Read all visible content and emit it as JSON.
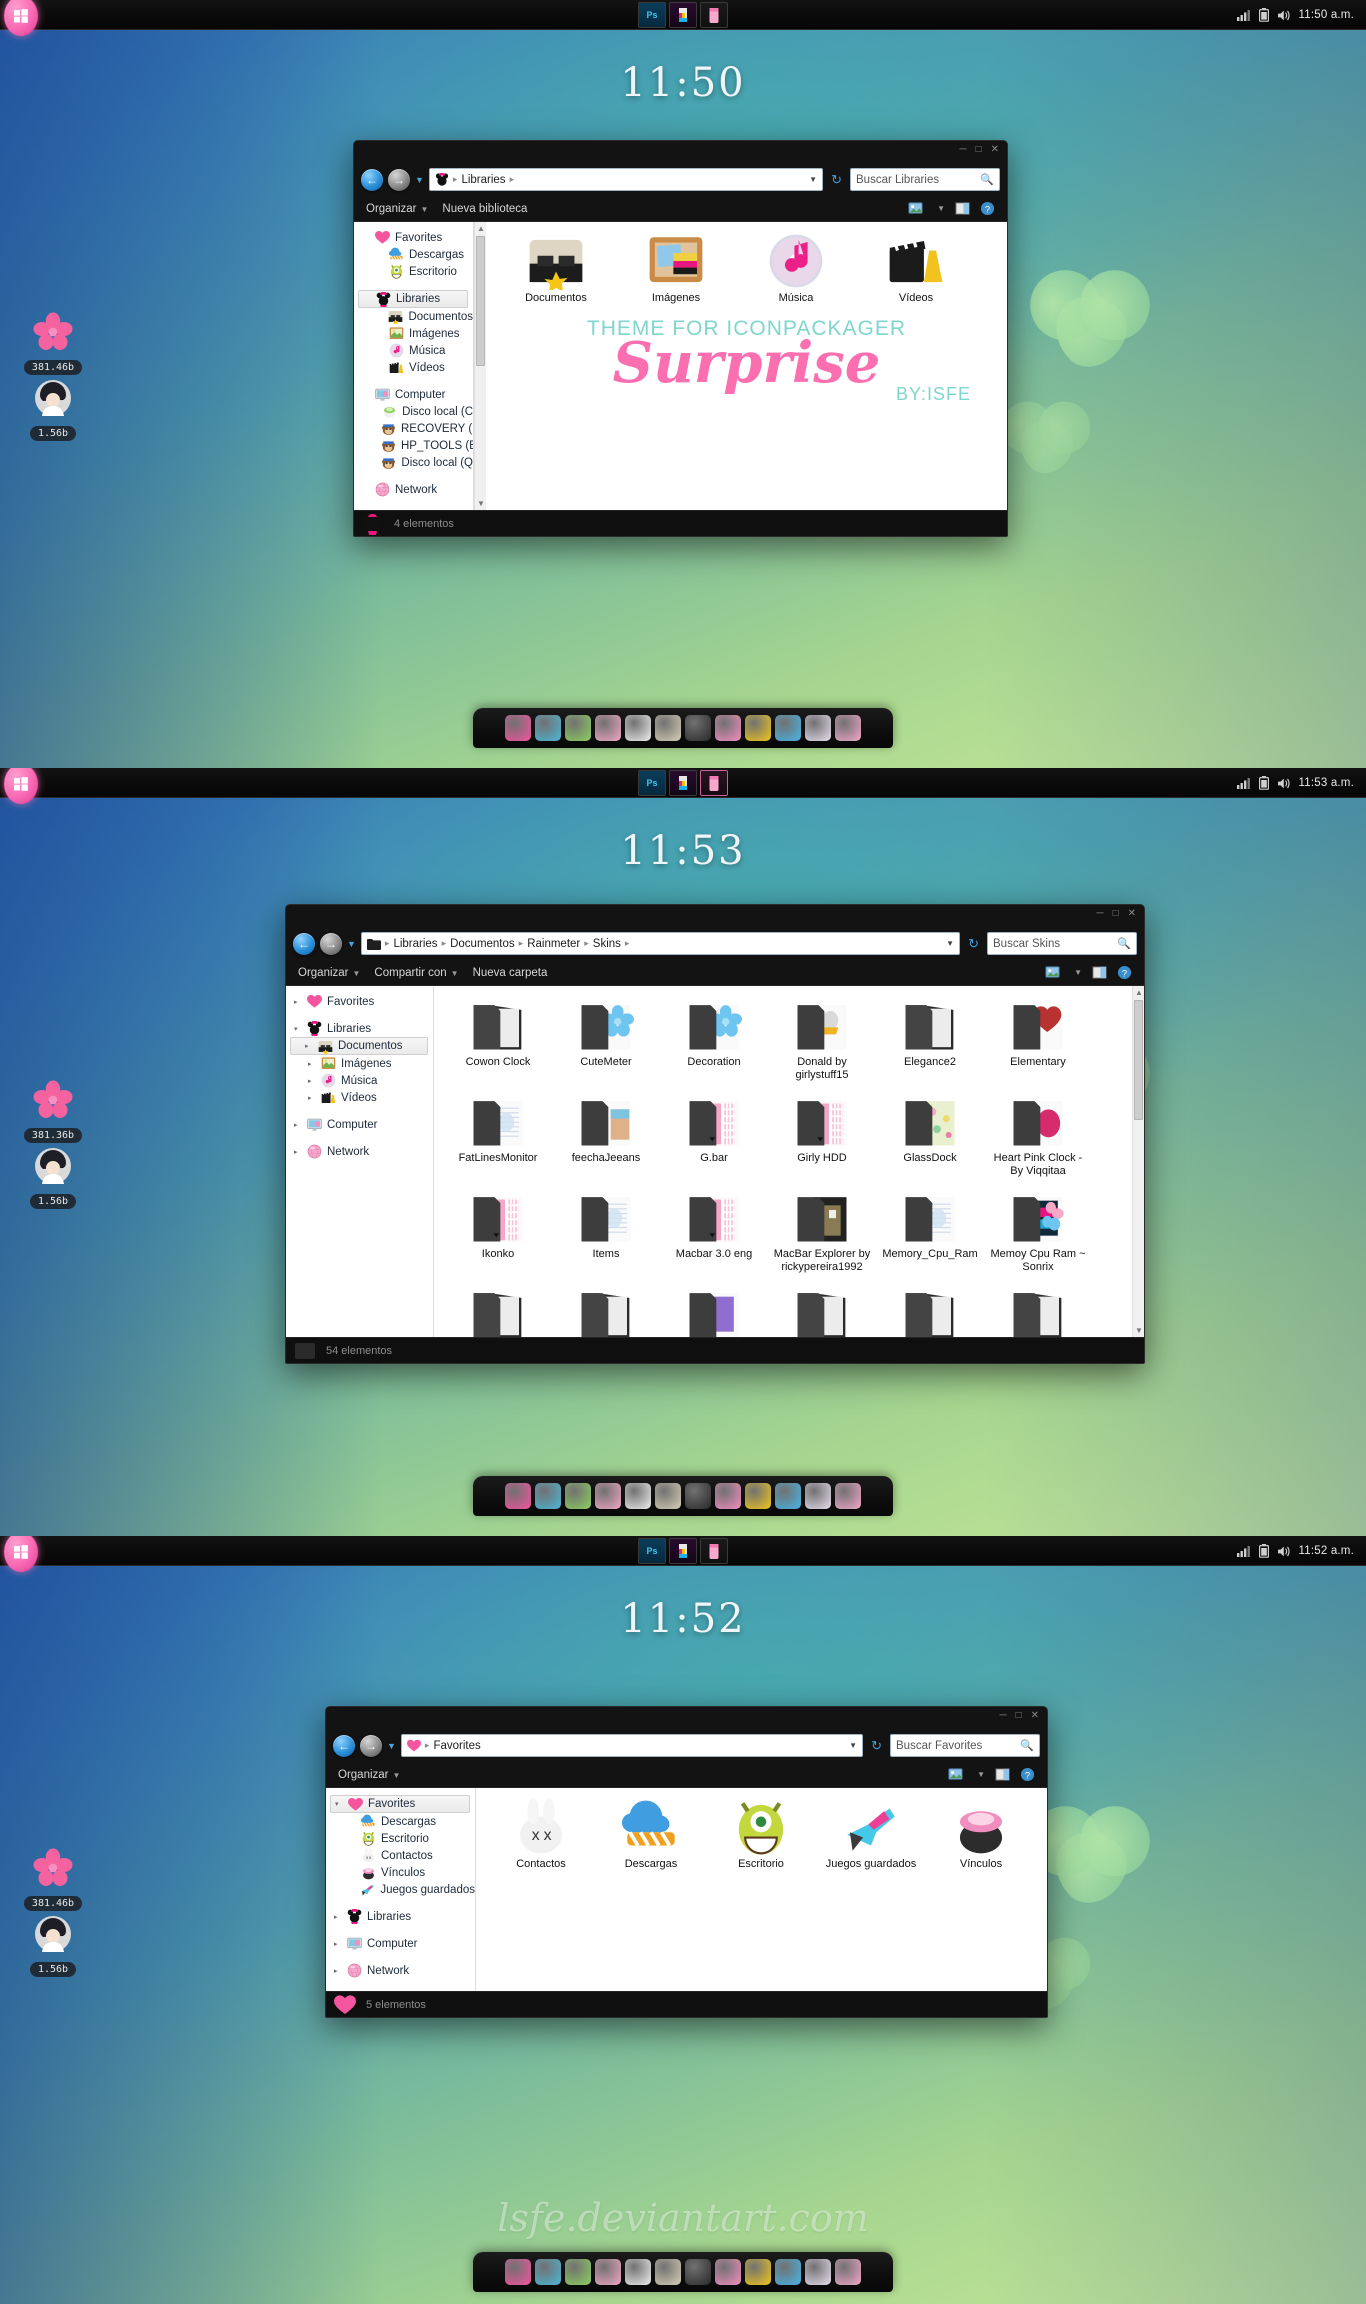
{
  "taskbar": {
    "start_icon": "windows-start-orb",
    "buttons": [
      {
        "name": "photoshop-taskbar-button",
        "label": "Ps"
      },
      {
        "name": "paint-taskbar-button",
        "label": ""
      },
      {
        "name": "pink-app-taskbar-button",
        "label": ""
      }
    ],
    "tray_icons": [
      "network-signal-icon",
      "battery-icon",
      "volume-icon"
    ],
    "clocks": [
      "11:50 a.m.",
      "11:53 a.m.",
      "11:52 a.m."
    ]
  },
  "desktop": {
    "clocks": [
      "11:50",
      "11:53",
      "11:52"
    ],
    "gadgets": [
      {
        "icon": "pink-flower-drive-gadget",
        "value": "381.46b"
      },
      {
        "icon": "girl-avatar-drive-gadget",
        "value": "1.56b"
      }
    ],
    "gadgets_panel2": [
      {
        "icon": "pink-flower-drive-gadget",
        "value": "381.36b"
      },
      {
        "icon": "girl-avatar-drive-gadget",
        "value": "1.56b"
      }
    ],
    "gadgets_panel3": [
      {
        "icon": "pink-flower-drive-gadget",
        "value": "381.46b"
      },
      {
        "icon": "girl-avatar-drive-gadget",
        "value": "1.56b"
      }
    ],
    "watermark": "lsfe.deviantart.com",
    "dock_icons": [
      "minnie-icon",
      "watering-can-icon",
      "green-dragon-icon",
      "photoshop-pink-icon",
      "white-ghost-icon",
      "glasses-folder-icon",
      "film-clapper-icon",
      "quotes-icon",
      "toolbox-icon",
      "water-drop-icon",
      "pictures-icon",
      "pink-globe-icon"
    ]
  },
  "window1": {
    "nav": {
      "back_icon": "back-arrow-icon",
      "forward_icon": "forward-arrow-icon",
      "history_icon": "history-dropdown-icon",
      "breadcrumb_icon": "minnie-libraries-icon",
      "breadcrumbs": [
        "Libraries"
      ],
      "refresh_icon": "refresh-icon",
      "search_placeholder": "Buscar Libraries",
      "search_icon": "search-icon"
    },
    "toolbar": {
      "organize": "Organizar",
      "new_library": "Nueva biblioteca",
      "view_icon": "change-view-icon",
      "preview_icon": "preview-pane-icon",
      "help_icon": "help-icon"
    },
    "sidebar": [
      {
        "label": "Favorites",
        "icon": "pink-heart-icon",
        "level": 0,
        "selected": false,
        "arrow": false
      },
      {
        "label": "Descargas",
        "icon": "blue-cloud-icon",
        "level": 1,
        "selected": false,
        "arrow": false
      },
      {
        "label": "Escritorio",
        "icon": "green-monster-icon",
        "level": 1,
        "selected": false,
        "arrow": false
      },
      {
        "gap": true
      },
      {
        "label": "Libraries",
        "icon": "minnie-icon",
        "level": 0,
        "selected": true,
        "arrow": false
      },
      {
        "label": "Documentos",
        "icon": "documents-glasses-icon",
        "level": 1,
        "selected": false,
        "arrow": false
      },
      {
        "label": "Imágenes",
        "icon": "pictures-icon",
        "level": 1,
        "selected": false,
        "arrow": false
      },
      {
        "label": "Música",
        "icon": "music-cd-icon",
        "level": 1,
        "selected": false,
        "arrow": false
      },
      {
        "label": "Vídeos",
        "icon": "video-clapper-icon",
        "level": 1,
        "selected": false,
        "arrow": false
      },
      {
        "gap": true
      },
      {
        "label": "Computer",
        "icon": "computer-monitor-icon",
        "level": 0,
        "selected": false,
        "arrow": false
      },
      {
        "label": "Disco local (C",
        "icon": "green-pot-drive-icon",
        "level": 1,
        "selected": false,
        "arrow": false
      },
      {
        "label": "RECOVERY (D",
        "icon": "monkey-drive-icon",
        "level": 1,
        "selected": false,
        "arrow": false
      },
      {
        "label": "HP_TOOLS (E",
        "icon": "monkey-drive-icon",
        "level": 1,
        "selected": false,
        "arrow": false
      },
      {
        "label": "Disco local (Q",
        "icon": "monkey-drive-icon",
        "level": 1,
        "selected": false,
        "arrow": false
      },
      {
        "gap": true
      },
      {
        "label": "Network",
        "icon": "pink-globe-icon",
        "level": 0,
        "selected": false,
        "arrow": false
      }
    ],
    "items": [
      {
        "label": "Documentos",
        "icon": "documents-glasses-icon"
      },
      {
        "label": "Imágenes",
        "icon": "pictures-corkboard-icon"
      },
      {
        "label": "Música",
        "icon": "music-cd-icon"
      },
      {
        "label": "Vídeos",
        "icon": "video-clapper-icon"
      }
    ],
    "promo": {
      "line1": "THEME FOR ICONPACKAGER",
      "line2": "Surprise",
      "line3": "BY:ISFE"
    },
    "status": {
      "icon": "minnie-status-icon",
      "text": "4 elementos"
    }
  },
  "window2": {
    "nav": {
      "breadcrumb_icon": "black-folder-icon",
      "breadcrumbs": [
        "Libraries",
        "Documentos",
        "Rainmeter",
        "Skins"
      ],
      "search_placeholder": "Buscar Skins"
    },
    "toolbar": {
      "organize": "Organizar",
      "share": "Compartir con",
      "new_folder": "Nueva carpeta"
    },
    "sidebar": [
      {
        "label": "Favorites",
        "icon": "pink-heart-icon",
        "level": 0,
        "selected": false,
        "arrow": true
      },
      {
        "gap": true
      },
      {
        "label": "Libraries",
        "icon": "minnie-icon",
        "level": 0,
        "selected": false,
        "arrow": "open"
      },
      {
        "label": "Documentos",
        "icon": "documents-glasses-icon",
        "level": 1,
        "selected": true,
        "arrow": true
      },
      {
        "label": "Imágenes",
        "icon": "pictures-icon",
        "level": 1,
        "selected": false,
        "arrow": true
      },
      {
        "label": "Música",
        "icon": "music-cd-icon",
        "level": 1,
        "selected": false,
        "arrow": true
      },
      {
        "label": "Vídeos",
        "icon": "video-clapper-icon",
        "level": 1,
        "selected": false,
        "arrow": true
      },
      {
        "gap": true
      },
      {
        "label": "Computer",
        "icon": "computer-monitor-icon",
        "level": 0,
        "selected": false,
        "arrow": true
      },
      {
        "gap": true
      },
      {
        "label": "Network",
        "icon": "pink-globe-icon",
        "level": 0,
        "selected": false,
        "arrow": true
      }
    ],
    "items": [
      {
        "label": "Cowon Clock",
        "icon": "folder-dark-icon"
      },
      {
        "label": "CuteMeter",
        "icon": "folder-blue-flower-icon"
      },
      {
        "label": "Decoration",
        "icon": "folder-blue-flower-icon"
      },
      {
        "label": "Donald by girlystuff15",
        "icon": "folder-donald-icon"
      },
      {
        "label": "Elegance2",
        "icon": "folder-dark-icon"
      },
      {
        "label": "Elementary",
        "icon": "folder-red-icon"
      },
      {
        "label": "FatLinesMonitor",
        "icon": "folder-paper-icon"
      },
      {
        "label": "feechaJeeans",
        "icon": "folder-jeans-icon"
      },
      {
        "label": "G.bar",
        "icon": "folder-pink-stripe-icon"
      },
      {
        "label": "Girly HDD",
        "icon": "folder-pink-stripe-icon"
      },
      {
        "label": "GlassDock",
        "icon": "folder-green-pattern-icon"
      },
      {
        "label": "Heart Pink Clock - By Viqqitaa",
        "icon": "folder-pink-heart-icon"
      },
      {
        "label": "Ikonko",
        "icon": "folder-pink-stripe-icon"
      },
      {
        "label": "Items",
        "icon": "folder-paper-icon"
      },
      {
        "label": "Macbar 3.0 eng",
        "icon": "folder-pink-stripe-icon"
      },
      {
        "label": "MacBar Explorer by rickypereira1992",
        "icon": "folder-photo-icon"
      },
      {
        "label": "Memory_Cpu_Ram",
        "icon": "folder-paper-icon"
      },
      {
        "label": "Memoy Cpu Ram ~ Sonrix",
        "icon": "folder-colorful-icon"
      },
      {
        "label": "",
        "icon": "folder-dark-icon"
      },
      {
        "label": "",
        "icon": "folder-dark-icon"
      },
      {
        "label": "",
        "icon": "folder-purple-icon"
      },
      {
        "label": "",
        "icon": "folder-dark-icon"
      },
      {
        "label": "",
        "icon": "folder-dark-icon"
      },
      {
        "label": "",
        "icon": "folder-dark-icon"
      }
    ],
    "status": {
      "icon": "dark-status-icon",
      "text": "54 elementos"
    }
  },
  "window3": {
    "nav": {
      "breadcrumb_icon": "pink-heart-icon",
      "breadcrumbs": [
        "Favorites"
      ],
      "search_placeholder": "Buscar Favorites"
    },
    "toolbar": {
      "organize": "Organizar"
    },
    "sidebar": [
      {
        "label": "Favorites",
        "icon": "pink-heart-icon",
        "level": 0,
        "selected": true,
        "arrow": "open"
      },
      {
        "label": "Descargas",
        "icon": "blue-cloud-icon",
        "level": 1,
        "selected": false,
        "arrow": false
      },
      {
        "label": "Escritorio",
        "icon": "green-monster-icon",
        "level": 1,
        "selected": false,
        "arrow": false
      },
      {
        "label": "Contactos",
        "icon": "white-bunny-icon",
        "level": 1,
        "selected": false,
        "arrow": false
      },
      {
        "label": "Vínculos",
        "icon": "pink-pot-icon",
        "level": 1,
        "selected": false,
        "arrow": false
      },
      {
        "label": "Juegos guardados",
        "icon": "ray-gun-icon",
        "level": 1,
        "selected": false,
        "arrow": false
      },
      {
        "gap": true
      },
      {
        "label": "Libraries",
        "icon": "minnie-icon",
        "level": 0,
        "selected": false,
        "arrow": true
      },
      {
        "gap": true
      },
      {
        "label": "Computer",
        "icon": "computer-monitor-icon",
        "level": 0,
        "selected": false,
        "arrow": true
      },
      {
        "gap": true
      },
      {
        "label": "Network",
        "icon": "pink-globe-icon",
        "level": 0,
        "selected": false,
        "arrow": true
      }
    ],
    "items": [
      {
        "label": "Contactos",
        "icon": "white-bunny-icon"
      },
      {
        "label": "Descargas",
        "icon": "blue-cloud-icon"
      },
      {
        "label": "Escritorio",
        "icon": "green-monster-icon"
      },
      {
        "label": "Juegos guardados",
        "icon": "ray-gun-icon"
      },
      {
        "label": "Vínculos",
        "icon": "pink-pot-icon"
      }
    ],
    "status": {
      "icon": "pink-heart-icon",
      "text": "5 elementos"
    }
  },
  "colors": {
    "accent_pink": "#fb6fb0",
    "accent_teal": "#7fd6cd",
    "taskbar": "#0b0b0b",
    "window_chrome": "#131313"
  }
}
